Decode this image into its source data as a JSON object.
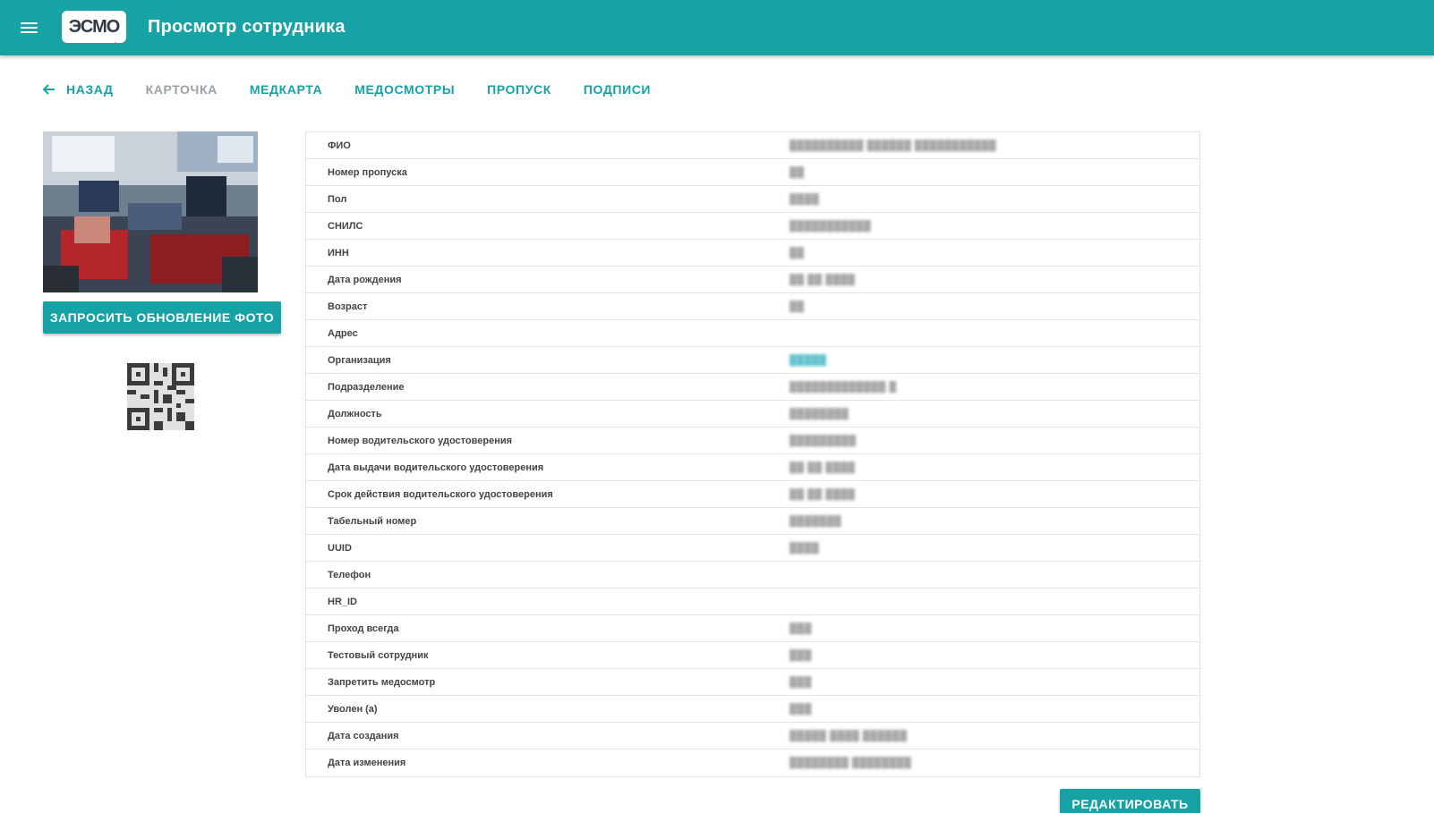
{
  "header": {
    "logo_text": "ЭСМО",
    "title": "Просмотр сотрудника"
  },
  "tabs": [
    {
      "label": "НАЗАД",
      "type": "back"
    },
    {
      "label": "КАРТОЧКА",
      "active": true
    },
    {
      "label": "МЕДКАРТА"
    },
    {
      "label": "МЕДОСМОТРЫ"
    },
    {
      "label": "ПРОПУСК"
    },
    {
      "label": "ПОДПИСИ"
    }
  ],
  "left": {
    "update_photo_label": "ЗАПРОСИТЬ ОБНОВЛЕНИЕ ФОТО"
  },
  "employee": {
    "rows": [
      {
        "label": "ФИО",
        "value": "██████████ ██████ ███████████"
      },
      {
        "label": "Номер пропуска",
        "value": "██"
      },
      {
        "label": "Пол",
        "value": "████"
      },
      {
        "label": "СНИЛС",
        "value": "███████████"
      },
      {
        "label": "ИНН",
        "value": "██"
      },
      {
        "label": "Дата рождения",
        "value": "██ ██ ████"
      },
      {
        "label": "Возраст",
        "value": "██"
      },
      {
        "label": "Адрес",
        "value": ""
      },
      {
        "label": "Организация",
        "value": "█████"
      },
      {
        "label": "Подразделение",
        "value": "█████████████ █"
      },
      {
        "label": "Должность",
        "value": "████████"
      },
      {
        "label": "Номер водительского удостоверения",
        "value": "█████████"
      },
      {
        "label": "Дата выдачи водительского удостоверения",
        "value": "██ ██ ████"
      },
      {
        "label": "Срок действия водительского удостоверения",
        "value": "██ ██ ████"
      },
      {
        "label": "Табельный номер",
        "value": "███████"
      },
      {
        "label": "UUID",
        "value": "████"
      },
      {
        "label": "Телефон",
        "value": ""
      },
      {
        "label": "HR_ID",
        "value": ""
      },
      {
        "label": "Проход всегда",
        "value": "███"
      },
      {
        "label": "Тестовый сотрудник",
        "value": "███"
      },
      {
        "label": "Запретить медосмотр",
        "value": "███"
      },
      {
        "label": "Уволен (а)",
        "value": "███"
      },
      {
        "label": "Дата создания",
        "value": "█████ ████ ██████"
      },
      {
        "label": "Дата изменения",
        "value": "████████ ████████"
      }
    ]
  },
  "actions": {
    "edit_label": "РЕДАКТИРОВАТЬ"
  },
  "colors": {
    "primary": "#17a2a5",
    "disabled_tab": "#9aa0a3"
  },
  "icons": {
    "menu": "menu-icon",
    "back": "arrow-left-icon"
  }
}
